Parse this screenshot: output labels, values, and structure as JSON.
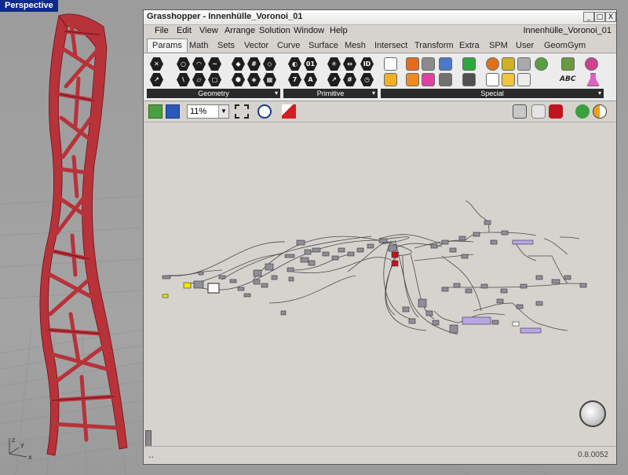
{
  "viewport": {
    "label": "Perspective"
  },
  "axes": {
    "x": "x",
    "y": "y",
    "z": "z"
  },
  "grasshopper": {
    "title": "Grasshopper - Innenhülle_Voronoi_01",
    "window_buttons": [
      "_",
      "□",
      "X"
    ],
    "menu": [
      "File",
      "Edit",
      "View",
      "Arrange",
      "Solution",
      "Window",
      "Help"
    ],
    "document_name": "Innenhülle_Voronoi_01",
    "tabs": [
      "Params",
      "Math",
      "Sets",
      "Vector",
      "Curve",
      "Surface",
      "Mesh",
      "Intersect",
      "Transform",
      "Extra",
      "SPM",
      "User",
      "GeomGym"
    ],
    "active_tab": "Params",
    "panels": [
      {
        "name": "Geometry"
      },
      {
        "name": "Primitive"
      },
      {
        "name": "Special"
      }
    ],
    "primitive_icon_labels": [
      "01",
      "ID",
      "7",
      "A"
    ],
    "special_icon_label": "ABC",
    "zoom": "11%",
    "status": "..",
    "version": "0.8.0052"
  },
  "colors": {
    "accent_title": "#0b2a8a",
    "tower": "#b8323a",
    "component": "#8e8e98",
    "selected_component": "#b8a6e6",
    "param_red": "#c0141e",
    "param_yellow": "#f2e200",
    "wire": "#4a4a4a"
  }
}
